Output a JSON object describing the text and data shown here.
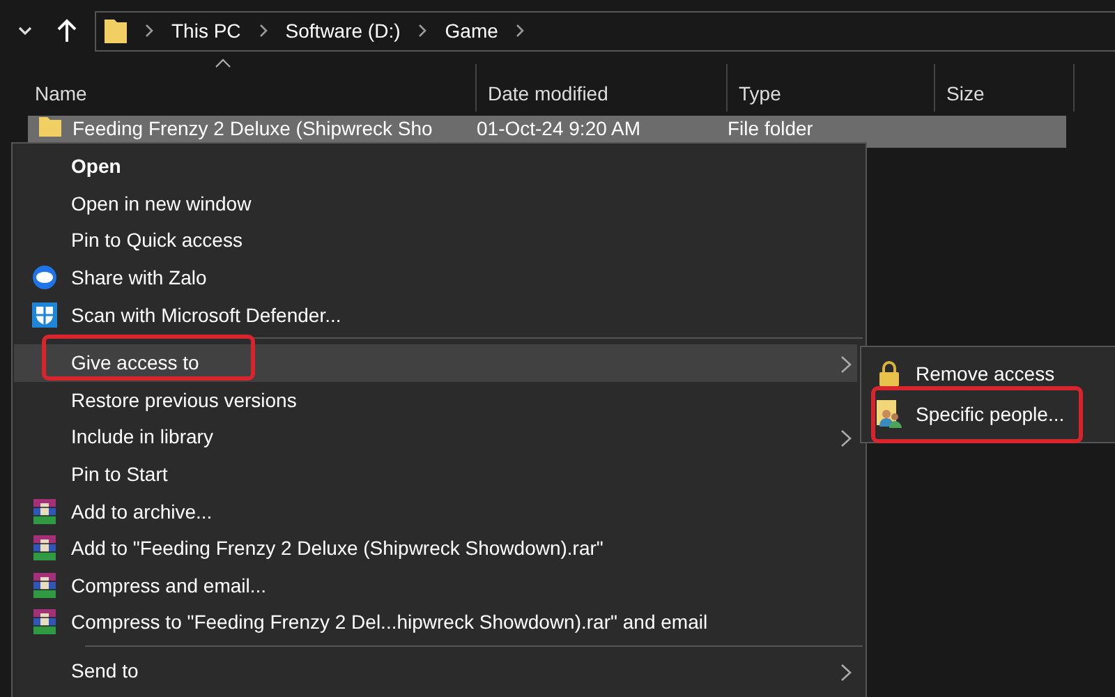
{
  "address_bar": {
    "path": [
      "This PC",
      "Software (D:)",
      "Game"
    ]
  },
  "columns": [
    {
      "label": "Name",
      "sorted": true
    },
    {
      "label": "Date modified"
    },
    {
      "label": "Type"
    },
    {
      "label": "Size"
    }
  ],
  "rows": [
    {
      "name": "Feeding Frenzy 2 Deluxe (Shipwreck Sho",
      "date_modified": "01-Oct-24 9:20 AM",
      "type": "File folder",
      "selected": true
    }
  ],
  "context_menu": {
    "items": [
      {
        "kind": "plain",
        "label": "Open",
        "bold": true
      },
      {
        "kind": "plain",
        "label": "Open in new window",
        "bold": false
      },
      {
        "kind": "plain",
        "label": "Pin to Quick access"
      },
      {
        "kind": "zalo",
        "label": "Share with Zalo"
      },
      {
        "kind": "defender",
        "label": "Scan with Microsoft Defender..."
      },
      {
        "kind": "separator"
      },
      {
        "kind": "plain",
        "label": "Give access to",
        "submenu": true,
        "selected": true,
        "annotated": true
      },
      {
        "kind": "plain",
        "label": "Restore previous versions",
        "selected": false
      },
      {
        "kind": "plain",
        "label": "Include in library",
        "submenu": true
      },
      {
        "kind": "plain",
        "label": "Pin to Start"
      },
      {
        "kind": "archive",
        "label": "Add to archive..."
      },
      {
        "kind": "archive",
        "label": "Add to \"Feeding Frenzy 2 Deluxe (Shipwreck Showdown).rar\""
      },
      {
        "kind": "archive",
        "label": "Compress and email..."
      },
      {
        "kind": "archive",
        "label": "Compress to \"Feeding Frenzy 2 Del...hipwreck Showdown).rar\" and email"
      },
      {
        "kind": "separator"
      },
      {
        "kind": "plain",
        "label": "Send to",
        "submenu": true
      }
    ]
  },
  "submenu": {
    "items": [
      {
        "kind": "lock",
        "label": "Remove access"
      },
      {
        "kind": "people",
        "label": "Specific people...",
        "annotated": true
      }
    ]
  }
}
